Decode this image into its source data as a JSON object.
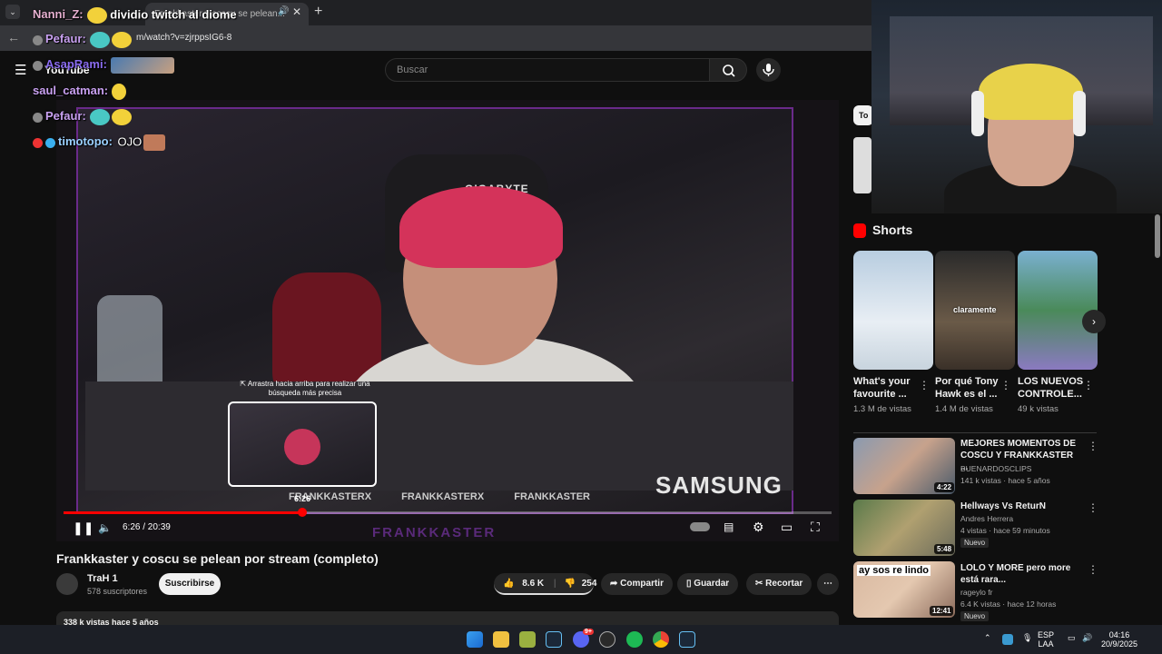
{
  "browser": {
    "tab_title": "Frankkaster y coscu se pelean...",
    "url": "m/watch?v=zjrppsIG6-8"
  },
  "youtube": {
    "logo": "YouTube",
    "search_placeholder": "Buscar",
    "chip_label": "To"
  },
  "player": {
    "chair_logo": "GIGABYTE",
    "sponsor": "SAMSUNG",
    "socials": [
      "FRANKKASTERX",
      "FRANKKASTERX",
      "FRANKKASTER"
    ],
    "bottom_text": "FRANKKASTER",
    "time": "6:26 / 20:39",
    "preview_time": "6:26",
    "preview_hint": "⇱ Arrastra hacia arriba para realizar una búsqueda más precisa",
    "progress": 0.311
  },
  "video": {
    "title": "Frankkaster y coscu se pelean por stream (completo)",
    "channel": "TraH 1",
    "subscribers": "578 suscriptores",
    "subscribe_label": "Suscribirse",
    "likes": "8.6 K",
    "dislikes": "254",
    "share_label": "Compartir",
    "save_label": "Guardar",
    "clip_label": "Recortar",
    "desc_meta": "338 k vistas  hace 5 años"
  },
  "chat": [
    {
      "user": "Nanni_Z:",
      "text": "dividio twitch al diome",
      "color": "#e6b0d0"
    },
    {
      "user": "Pefaur:",
      "text": "",
      "color": "#c8a0f0"
    },
    {
      "user": "AsapRami:",
      "text": "",
      "color": "#8a6cf0"
    },
    {
      "user": "saul_catman:",
      "text": "",
      "color": "#c8a0f0"
    },
    {
      "user": "Pefaur:",
      "text": "",
      "color": "#c8a0f0"
    },
    {
      "user": "timotopo:",
      "text": "OJO",
      "color": "#9ad0ff"
    }
  ],
  "sidebar": {
    "shorts_heading": "Shorts",
    "shorts": [
      {
        "title": "What's your favourite ...",
        "views": "1.3 M de vistas"
      },
      {
        "title": "Por qué Tony Hawk es el ...",
        "views": "1.4 M de vistas",
        "overlay": "claramente"
      },
      {
        "title": "LOS NUEVOS CONTROLE...",
        "views": "49 k vistas"
      }
    ],
    "recommended": [
      {
        "title": "MEJORES MOMENTOS DE COSCU Y FRANKKASTER ...",
        "channel": "BUENARDOSCLIPS",
        "meta": "141 k vistas · hace 5 años",
        "duration": "4:22",
        "badge": ""
      },
      {
        "title": "Hellways Vs  ReturN",
        "channel": "Andres Herrera",
        "meta": "4 vistas · hace 59 minutos",
        "duration": "5:48",
        "badge": "Nuevo"
      },
      {
        "title": "LOLO Y MORE pero more está rara...",
        "channel": "rageylo fr",
        "meta": "6.4 K vistas · hace 12 horas",
        "duration": "12:41",
        "badge": "Nuevo",
        "thumb_text": "ay sos re lindo"
      }
    ]
  },
  "taskbar": {
    "lang_line1": "ESP",
    "lang_line2": "LAA",
    "time": "04:16",
    "date": "20/9/2025",
    "discord_badge": "9+"
  },
  "colors": {
    "accent_red": "#ff0000",
    "youtube_bg": "#0f0f0f",
    "overlay_purple": "#6a2a8a"
  }
}
